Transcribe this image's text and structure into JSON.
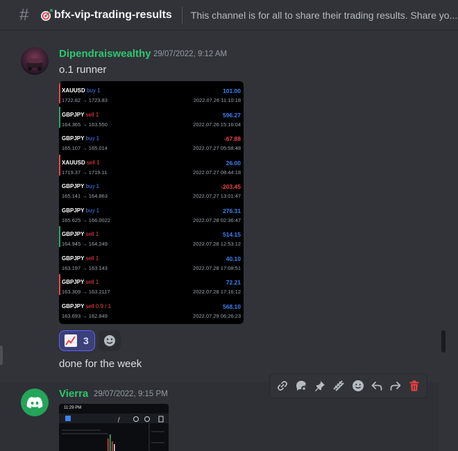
{
  "channel": {
    "name": "bfx-vip-trading-results",
    "topic": "This channel is for all to share their trading results. Share yo..."
  },
  "messages": [
    {
      "author": "Dipendraiswealthy",
      "author_color": "#2dc770",
      "timestamp": "29/07/2022, 9:12 AM",
      "text": "o.1 runner",
      "trades": [
        {
          "symbol": "XAUUSD",
          "side": "buy 1",
          "prices": "1722.82 → 1723.83",
          "profit": "101.00",
          "date": "2022.07.26 11:10:18",
          "bar_color": "#e5484d"
        },
        {
          "symbol": "GBPJPY",
          "side": "sell 1",
          "prices": "164.365 → 163.550",
          "profit": "596.27",
          "date": "2022.07.26 15:16:04",
          "bar_color": "#30a46c"
        },
        {
          "symbol": "GBPJPY",
          "side": "buy 1",
          "prices": "165.107 → 165.014",
          "profit": "-67.88",
          "date": "2022.07.27 05:58:48",
          "bar_color": ""
        },
        {
          "symbol": "XAUUSD",
          "side": "sell 1",
          "prices": "1719.37 → 1719.11",
          "profit": "26.00",
          "date": "2022.07.27 08:44:18",
          "bar_color": "#e5484d"
        },
        {
          "symbol": "GBPJPY",
          "side": "buy 1",
          "prices": "165.141 → 164.863",
          "profit": "-203.45",
          "date": "2022.07.27 13:01:47",
          "bar_color": ""
        },
        {
          "symbol": "GBPJPY",
          "side": "buy 1",
          "prices": "165.625 → 166.0022",
          "profit": "276.31",
          "date": "2022.07.28 02:36:47",
          "bar_color": ""
        },
        {
          "symbol": "GBPJPY",
          "side": "sell 1",
          "prices": "164.945 → 164.249",
          "profit": "514.15",
          "date": "2022.07.28 12:53:12",
          "bar_color": "#30a46c"
        },
        {
          "symbol": "GBPJPY",
          "side": "sell 1",
          "prices": "163.197 → 163.143",
          "profit": "40.10",
          "date": "2022.07.28 17:08:51",
          "bar_color": ""
        },
        {
          "symbol": "GBPJPY",
          "side": "sell 1",
          "prices": "163.309 → 163.2117",
          "profit": "72.21",
          "date": "2022.07.28 17:16:12",
          "bar_color": "#e5484d"
        },
        {
          "symbol": "GBPJPY",
          "side": "sell 0.9 / 1",
          "prices": "163.693 → 162.849",
          "profit": "568.10",
          "date": "2022.07.29 06:26:23",
          "bar_color": ""
        }
      ],
      "reaction": {
        "icon": "chart-increasing-icon",
        "count": "3"
      },
      "followup_text": "done for the week"
    },
    {
      "author": "Vierra",
      "author_color": "#2dc770",
      "timestamp": "29/07/2022, 9:15 PM",
      "screenshot_time": "11:29 PM"
    }
  ],
  "toolbar_icons": [
    "link-icon",
    "reply-thread-icon",
    "pin-icon",
    "apps-icon",
    "emoji-icon",
    "reply-icon",
    "forward-icon",
    "delete-icon"
  ],
  "colors": {
    "buy": "#3b82f6",
    "sell": "#ef4444",
    "profit_positive": "#3b82f6",
    "profit_negative": "#ef4444",
    "accent": "#5865f2",
    "danger": "#da373c"
  }
}
